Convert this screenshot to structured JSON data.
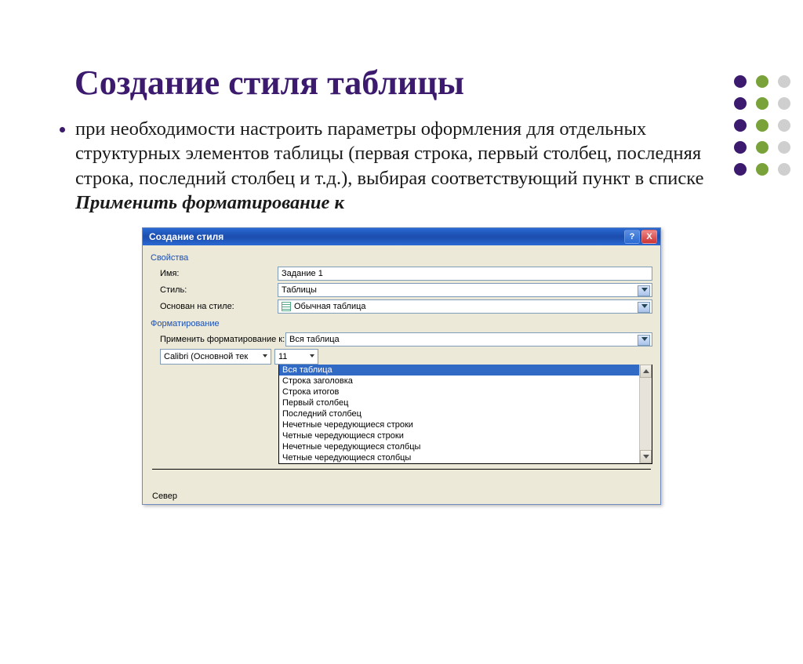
{
  "decor": {
    "dot_colors": [
      [
        "#3c1b6e",
        "#7aa23a",
        "#cfcfcf"
      ],
      [
        "#3c1b6e",
        "#7aa23a",
        "#cfcfcf"
      ],
      [
        "#3c1b6e",
        "#7aa23a",
        "#cfcfcf"
      ],
      [
        "#3c1b6e",
        "#7aa23a",
        "#cfcfcf"
      ],
      [
        "#3c1b6e",
        "#7aa23a",
        "#cfcfcf"
      ]
    ]
  },
  "slide": {
    "title": "Создание стиля таблицы",
    "bullet_pre": "при необходимости настроить параметры оформления для отдельных структурных элементов таблицы (первая строка, первый столбец, последняя строка, последний столбец и т.д.), выбирая соответствующий пункт в списке ",
    "bullet_bold": "Применить форматирование к"
  },
  "dialog": {
    "title": "Создание стиля",
    "help": "?",
    "close": "X",
    "section_properties": "Свойства",
    "label_name": "Имя:",
    "value_name": "Задание 1",
    "label_style": "Стиль:",
    "value_style": "Таблицы",
    "label_basedon": "Основан на стиле:",
    "value_basedon": "Обычная таблица",
    "section_formatting": "Форматирование",
    "label_applyto": "Применить форматирование к:",
    "value_applyto": "Вся таблица",
    "font_name": "Calibri (Основной тек",
    "font_size": "11",
    "dropdown_items": [
      "Вся таблица",
      "Строка заголовка",
      "Строка итогов",
      "Первый столбец",
      "Последний столбец",
      "Нечетные чередующиеся строки",
      "Четные чередующиеся строки",
      "Нечетные чередующиеся столбцы",
      "Четные чередующиеся столбцы"
    ],
    "dropdown_selected_index": 0,
    "preview_label": "Север"
  }
}
